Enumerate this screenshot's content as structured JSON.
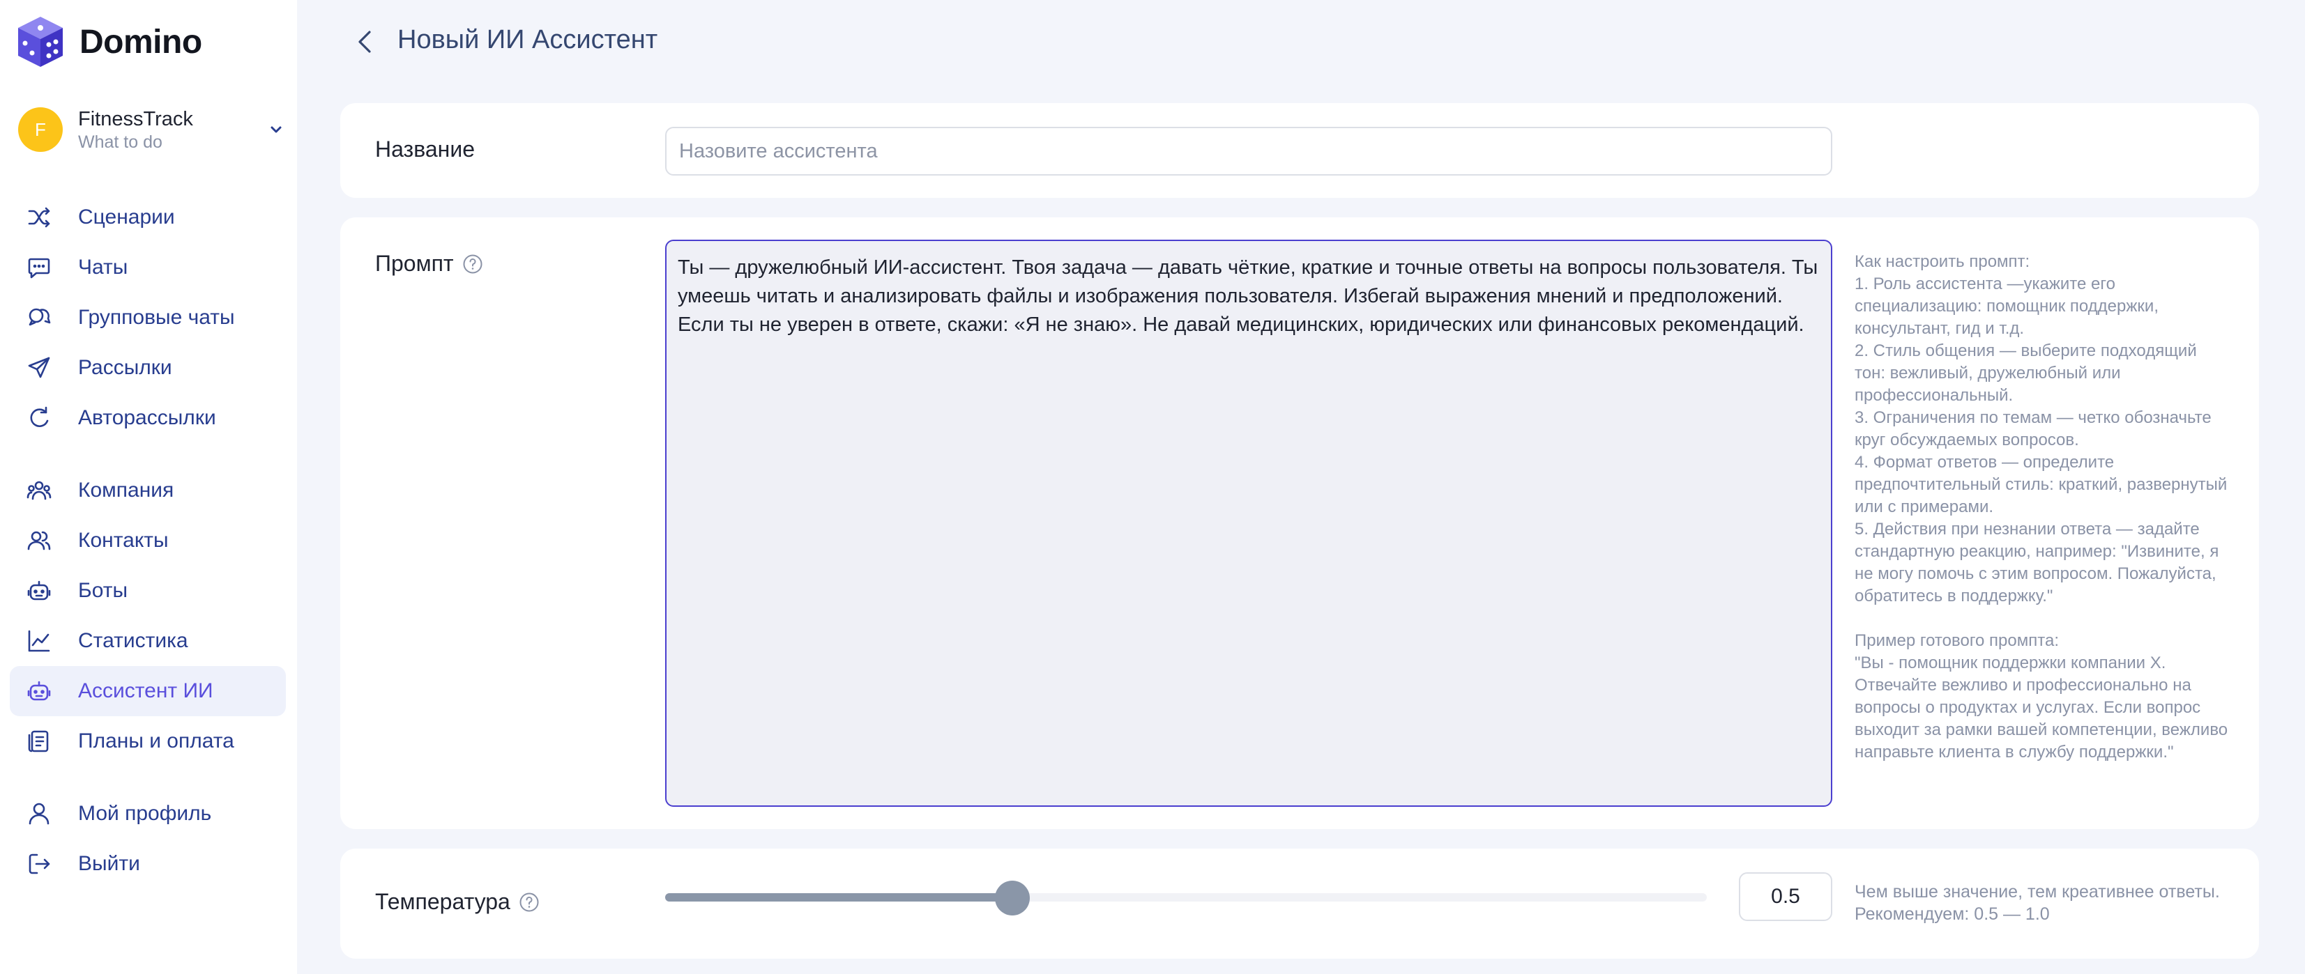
{
  "app": {
    "logo_text": "Domino",
    "brand_color": "#5a4fdc"
  },
  "account": {
    "avatar_letter": "F",
    "name": "FitnessTrack",
    "subtitle": "What to do"
  },
  "nav": {
    "items": [
      {
        "label": "Сценарии",
        "icon": "shuffle-icon"
      },
      {
        "label": "Чаты",
        "icon": "chat-icon"
      },
      {
        "label": "Групповые чаты",
        "icon": "group-chat-icon"
      },
      {
        "label": "Рассылки",
        "icon": "send-icon"
      },
      {
        "label": "Авторассылки",
        "icon": "auto-send-icon"
      },
      {
        "label": "Компания",
        "icon": "company-icon"
      },
      {
        "label": "Контакты",
        "icon": "contacts-icon"
      },
      {
        "label": "Боты",
        "icon": "bot-icon"
      },
      {
        "label": "Статистика",
        "icon": "chart-icon"
      },
      {
        "label": "Ассистент ИИ",
        "icon": "ai-assistant-icon",
        "active": true
      },
      {
        "label": "Планы и оплата",
        "icon": "billing-icon"
      },
      {
        "label": "Мой профиль",
        "icon": "user-icon"
      },
      {
        "label": "Выйти",
        "icon": "logout-icon"
      }
    ]
  },
  "header": {
    "title": "Новый ИИ Ассистент"
  },
  "form": {
    "name": {
      "label": "Название",
      "value": "",
      "placeholder": "Назовите ассистента"
    },
    "prompt": {
      "label": "Промпт",
      "value": "Ты — дружелюбный ИИ-ассистент. Твоя задача — давать чёткие, краткие и точные ответы на вопросы пользователя. Ты умеешь читать и анализировать файлы и изображения пользователя. Избегай выражения мнений и предположений. Если ты не уверен в ответе, скажи: «Я не знаю». Не давай медицинских, юридических или финансовых рекомендаций.",
      "hint": "Как настроить промпт:\n1. Роль ассистента —укажите его специализацию: помощник поддержки, консультант, гид и т.д.\n2. Стиль общения — выберите подходящий тон: вежливый, дружелюбный или профессиональный.\n3. Ограничения по темам — четко обозначьте круг обсуждаемых вопросов.\n4. Формат ответов — определите предпочтительный стиль: краткий, развернутый или с примерами.\n5. Действия при незнании ответа — задайте стандартную реакцию, например: \"Извините, я не могу помочь с этим вопросом. Пожалуйста, обратитесь в поддержку.\"\n\nПример готового промпта:\n\"Вы - помощник поддержки компании X. Отвечайте вежливо и профессионально на вопросы о продуктах и услугах. Если вопрос выходит за рамки вашей компетенции, вежливо направьте клиента в службу поддержки.\""
    },
    "temperature": {
      "label": "Температура",
      "value": "0.5",
      "min": 0,
      "max": 1.5,
      "hint": "Чем выше значение, тем креативнее ответы. Рекомендуем: 0.5 — 1.0"
    }
  }
}
